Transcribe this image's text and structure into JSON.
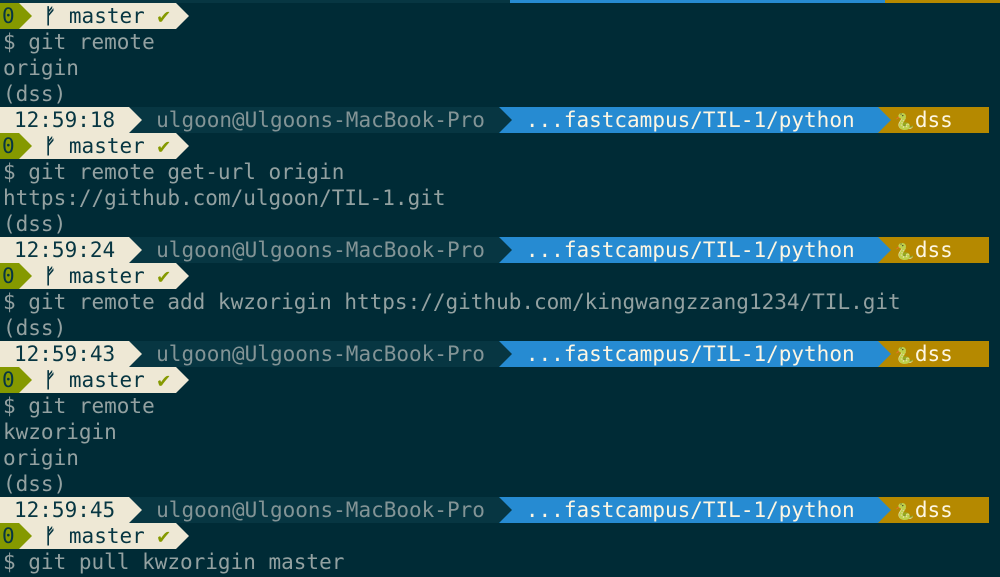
{
  "prompt": {
    "status": "0",
    "branch_icon": "git-branch-icon",
    "branch": "master",
    "check": "✔",
    "user_host": "ulgoon@Ulgoons-MacBook-Pro",
    "path": "...fastcampus/TIL-1/python",
    "env_icon": "snake-icon",
    "env_glyph": "🐍",
    "env": "dss",
    "dollar": "$"
  },
  "lines": [
    {
      "type": "branch"
    },
    {
      "type": "cmd",
      "text": "$ git remote"
    },
    {
      "type": "out",
      "text": "origin"
    },
    {
      "type": "out",
      "text": "(dss)"
    },
    {
      "type": "header",
      "time": "12:59:18"
    },
    {
      "type": "branch"
    },
    {
      "type": "cmd",
      "text": "$ git remote get-url origin"
    },
    {
      "type": "out",
      "text": "https://github.com/ulgoon/TIL-1.git"
    },
    {
      "type": "out",
      "text": "(dss)"
    },
    {
      "type": "header",
      "time": "12:59:24"
    },
    {
      "type": "branch"
    },
    {
      "type": "cmd",
      "text": "$ git remote add kwzorigin https://github.com/kingwangzzang1234/TIL.git"
    },
    {
      "type": "out",
      "text": "(dss)"
    },
    {
      "type": "header",
      "time": "12:59:43"
    },
    {
      "type": "branch"
    },
    {
      "type": "cmd",
      "text": "$ git remote"
    },
    {
      "type": "out",
      "text": "kwzorigin"
    },
    {
      "type": "out",
      "text": "origin"
    },
    {
      "type": "out",
      "text": "(dss)"
    },
    {
      "type": "header",
      "time": "12:59:45"
    },
    {
      "type": "branch"
    },
    {
      "type": "cmd",
      "text": "$ git pull kwzorigin master"
    }
  ],
  "colors": {
    "background": "#002b36",
    "time_bg": "#eee8d5",
    "host_bg": "#073642",
    "path_bg": "#268bd2",
    "env_bg": "#b58900",
    "status_bg": "#859900"
  }
}
